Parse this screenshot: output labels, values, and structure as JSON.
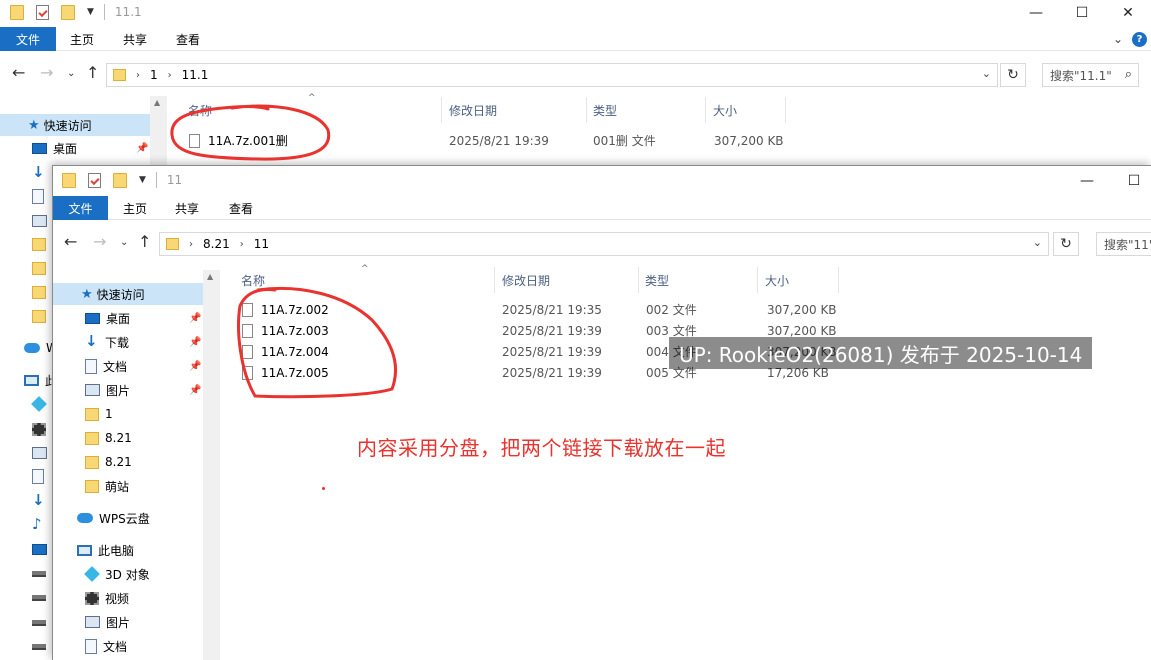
{
  "back_window": {
    "title": "11.1",
    "controls": {
      "minimize": "—",
      "maximize": "☐",
      "close": "✕"
    },
    "ribbon": {
      "file": "文件",
      "home": "主页",
      "share": "共享",
      "view": "查看",
      "collapse": "⌄",
      "help": "?"
    },
    "address": {
      "crumbs": [
        "1",
        "11.1"
      ]
    },
    "search_placeholder": "搜索\"11.1\"",
    "nav": {
      "quick_access": "快速访问",
      "desktop": "桌面",
      "wps_cloud_partial": "W",
      "this_pc_partial": "此"
    },
    "columns": {
      "name": "名称",
      "modified": "修改日期",
      "type": "类型",
      "size": "大小"
    },
    "files": [
      {
        "name": "11A.7z.001删",
        "modified": "2025/8/21 19:39",
        "type": "001删 文件",
        "size": "307,200 KB"
      }
    ]
  },
  "front_window": {
    "title": "11",
    "controls": {
      "minimize": "—",
      "maximize": "☐"
    },
    "ribbon": {
      "file": "文件",
      "home": "主页",
      "share": "共享",
      "view": "查看"
    },
    "address": {
      "crumbs": [
        "8.21",
        "11"
      ]
    },
    "search_placeholder": "搜索\"11\"",
    "nav": {
      "quick_access": "快速访问",
      "desktop": "桌面",
      "downloads": "下载",
      "documents": "文档",
      "pictures": "图片",
      "folder_1": "1",
      "folder_821a": "8.21",
      "folder_821b": "8.21",
      "folder_mengzhan": "萌站",
      "wps_cloud": "WPS云盘",
      "this_pc": "此电脑",
      "objects_3d": "3D 对象",
      "videos": "视频",
      "pc_pictures": "图片",
      "pc_documents": "文档"
    },
    "columns": {
      "name": "名称",
      "modified": "修改日期",
      "type": "类型",
      "size": "大小"
    },
    "files": [
      {
        "name": "11A.7z.002",
        "modified": "2025/8/21 19:35",
        "type": "002 文件",
        "size": "307,200 KB"
      },
      {
        "name": "11A.7z.003",
        "modified": "2025/8/21 19:39",
        "type": "003 文件",
        "size": "307,200 KB"
      },
      {
        "name": "11A.7z.004",
        "modified": "2025/8/21 19:39",
        "type": "004 文件",
        "size": "307,200 KB"
      },
      {
        "name": "11A.7z.005",
        "modified": "2025/8/21 19:39",
        "type": "005 文件",
        "size": "17,206 KB"
      }
    ]
  },
  "annotation": {
    "note": "内容采用分盘，把两个链接下载放在一起",
    "color": "#e8332e"
  },
  "watermark": "UP: RookieO2(26081) 发布于 2025-10-14",
  "colors": {
    "accent": "#1a6fc4",
    "selection": "#cce4f7"
  }
}
